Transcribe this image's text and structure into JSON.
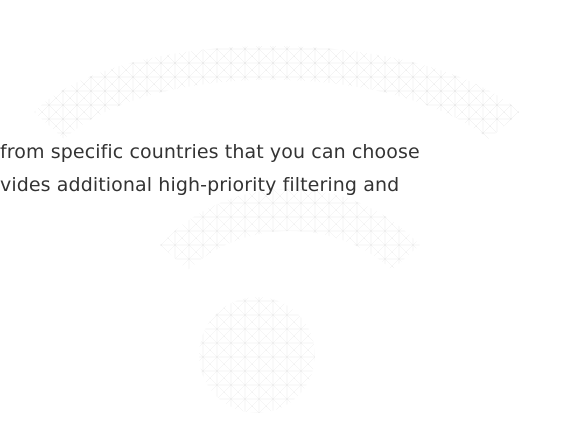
{
  "description": {
    "line1": "from specific countries that you can choose",
    "line2": "vides additional high-priority filtering and"
  },
  "decoration": {
    "icon": "wifi-icon",
    "color": "#d7d7d7"
  }
}
